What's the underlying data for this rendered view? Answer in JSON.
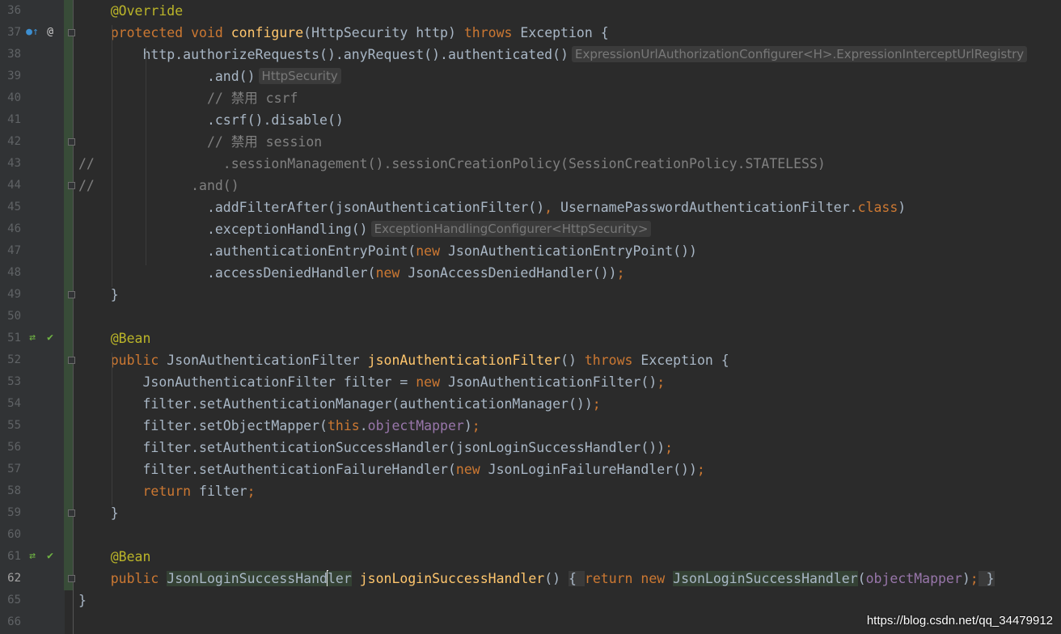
{
  "editor": {
    "lines": [
      {
        "num": "36",
        "segs": [
          [
            "ann",
            "    @Override"
          ]
        ]
      },
      {
        "num": "37",
        "segs": [
          [
            "kw",
            "    protected void "
          ],
          [
            "fn",
            "configure"
          ],
          [
            "",
            "(HttpSecurity http) "
          ],
          [
            "kw",
            "throws "
          ],
          [
            "",
            "Exception {"
          ]
        ]
      },
      {
        "num": "38",
        "segs": [
          [
            "",
            "        http.authorizeRequests().anyRequest().authenticated()"
          ]
        ],
        "hint": "ExpressionUrlAuthorizationConfigurer<H>.ExpressionInterceptUrlRegistry"
      },
      {
        "num": "39",
        "segs": [
          [
            "",
            "                .and()"
          ]
        ],
        "hint": "HttpSecurity"
      },
      {
        "num": "40",
        "segs": [
          [
            "cm",
            "                // 禁用 csrf"
          ]
        ]
      },
      {
        "num": "41",
        "segs": [
          [
            "",
            "                .csrf().disable()"
          ]
        ]
      },
      {
        "num": "42",
        "segs": [
          [
            "cm",
            "                // 禁用 session"
          ]
        ]
      },
      {
        "num": "43",
        "segs": [
          [
            "cm",
            "//                .sessionManagement().sessionCreationPolicy(SessionCreationPolicy.STATELESS)"
          ]
        ]
      },
      {
        "num": "44",
        "segs": [
          [
            "cm",
            "//            .and()"
          ]
        ]
      },
      {
        "num": "45",
        "segs": [
          [
            "",
            "                .addFilterAfter(jsonAuthenticationFilter()"
          ],
          [
            "kw",
            ", "
          ],
          [
            "",
            "UsernamePasswordAuthenticationFilter."
          ],
          [
            "kw",
            "class"
          ],
          [
            "",
            ")"
          ]
        ]
      },
      {
        "num": "46",
        "segs": [
          [
            "",
            "                .exceptionHandling()"
          ]
        ],
        "hint": "ExceptionHandlingConfigurer<HttpSecurity>"
      },
      {
        "num": "47",
        "segs": [
          [
            "",
            "                .authenticationEntryPoint("
          ],
          [
            "kw",
            "new "
          ],
          [
            "",
            "JsonAuthenticationEntryPoint())"
          ]
        ]
      },
      {
        "num": "48",
        "segs": [
          [
            "",
            "                .accessDeniedHandler("
          ],
          [
            "kw",
            "new "
          ],
          [
            "",
            "JsonAccessDeniedHandler())"
          ],
          [
            "kw",
            ";"
          ]
        ]
      },
      {
        "num": "49",
        "segs": [
          [
            "",
            "    }"
          ]
        ]
      },
      {
        "num": "50",
        "segs": []
      },
      {
        "num": "51",
        "segs": [
          [
            "ann",
            "    @Bean"
          ]
        ]
      },
      {
        "num": "52",
        "segs": [
          [
            "kw",
            "    public "
          ],
          [
            "",
            "JsonAuthenticationFilter "
          ],
          [
            "fn",
            "jsonAuthenticationFilter"
          ],
          [
            "",
            "() "
          ],
          [
            "kw",
            "throws "
          ],
          [
            "",
            "Exception {"
          ]
        ]
      },
      {
        "num": "53",
        "segs": [
          [
            "",
            "        JsonAuthenticationFilter filter = "
          ],
          [
            "kw",
            "new "
          ],
          [
            "",
            "JsonAuthenticationFilter()"
          ],
          [
            "kw",
            ";"
          ]
        ]
      },
      {
        "num": "54",
        "segs": [
          [
            "",
            "        filter.setAuthenticationManager(authenticationManager())"
          ],
          [
            "kw",
            ";"
          ]
        ]
      },
      {
        "num": "55",
        "segs": [
          [
            "",
            "        filter.setObjectMapper("
          ],
          [
            "kw",
            "this"
          ],
          [
            "",
            "."
          ],
          [
            "fld",
            "objectMapper"
          ],
          [
            "",
            ")"
          ],
          [
            "kw",
            ";"
          ]
        ]
      },
      {
        "num": "56",
        "segs": [
          [
            "",
            "        filter.setAuthenticationSuccessHandler(jsonLoginSuccessHandler())"
          ],
          [
            "kw",
            ";"
          ]
        ]
      },
      {
        "num": "57",
        "segs": [
          [
            "",
            "        filter.setAuthenticationFailureHandler("
          ],
          [
            "kw",
            "new "
          ],
          [
            "",
            "JsonLoginFailureHandler())"
          ],
          [
            "kw",
            ";"
          ]
        ]
      },
      {
        "num": "58",
        "segs": [
          [
            "kw",
            "        return "
          ],
          [
            "",
            "filter"
          ],
          [
            "kw",
            ";"
          ]
        ]
      },
      {
        "num": "59",
        "segs": [
          [
            "",
            "    }"
          ]
        ]
      },
      {
        "num": "60",
        "segs": []
      },
      {
        "num": "61",
        "segs": [
          [
            "ann",
            "    @Bean"
          ]
        ]
      },
      {
        "num": "62",
        "segs": [
          [
            "kw",
            "    public "
          ],
          [
            "hl",
            "JsonLoginSuccessHand"
          ],
          [
            "caret",
            ""
          ],
          [
            "hl",
            "ler"
          ],
          [
            "",
            " "
          ],
          [
            "fn",
            "jsonLoginSuccessHandler"
          ],
          [
            "",
            "() "
          ],
          [
            "fold",
            "{ "
          ],
          [
            "kw",
            "return new "
          ],
          [
            "hl",
            "JsonLoginSuccessHandler"
          ],
          [
            "",
            "("
          ],
          [
            "fld",
            "objectMapper"
          ],
          [
            "",
            ")"
          ],
          [
            "kw",
            ";"
          ],
          [
            "fold",
            " }"
          ]
        ]
      },
      {
        "num": "65",
        "segs": [
          [
            "",
            "}"
          ]
        ]
      },
      {
        "num": "66",
        "segs": []
      }
    ],
    "current_line": "62"
  },
  "gutter_icons": {
    "37": [
      "override-method-icon",
      "annotation-icon"
    ],
    "51": [
      "bean-navigate-icon",
      "bean-check-icon"
    ],
    "61": [
      "bean-navigate-icon",
      "bean-check-icon"
    ]
  },
  "watermark": "https://blog.csdn.net/qq_34479912",
  "colors": {
    "background": "#2b2b2b",
    "keyword": "#cc7832",
    "annotation": "#bbb529",
    "method": "#ffc66d",
    "comment": "#808080",
    "field": "#9876aa",
    "text": "#a9b7c6"
  }
}
